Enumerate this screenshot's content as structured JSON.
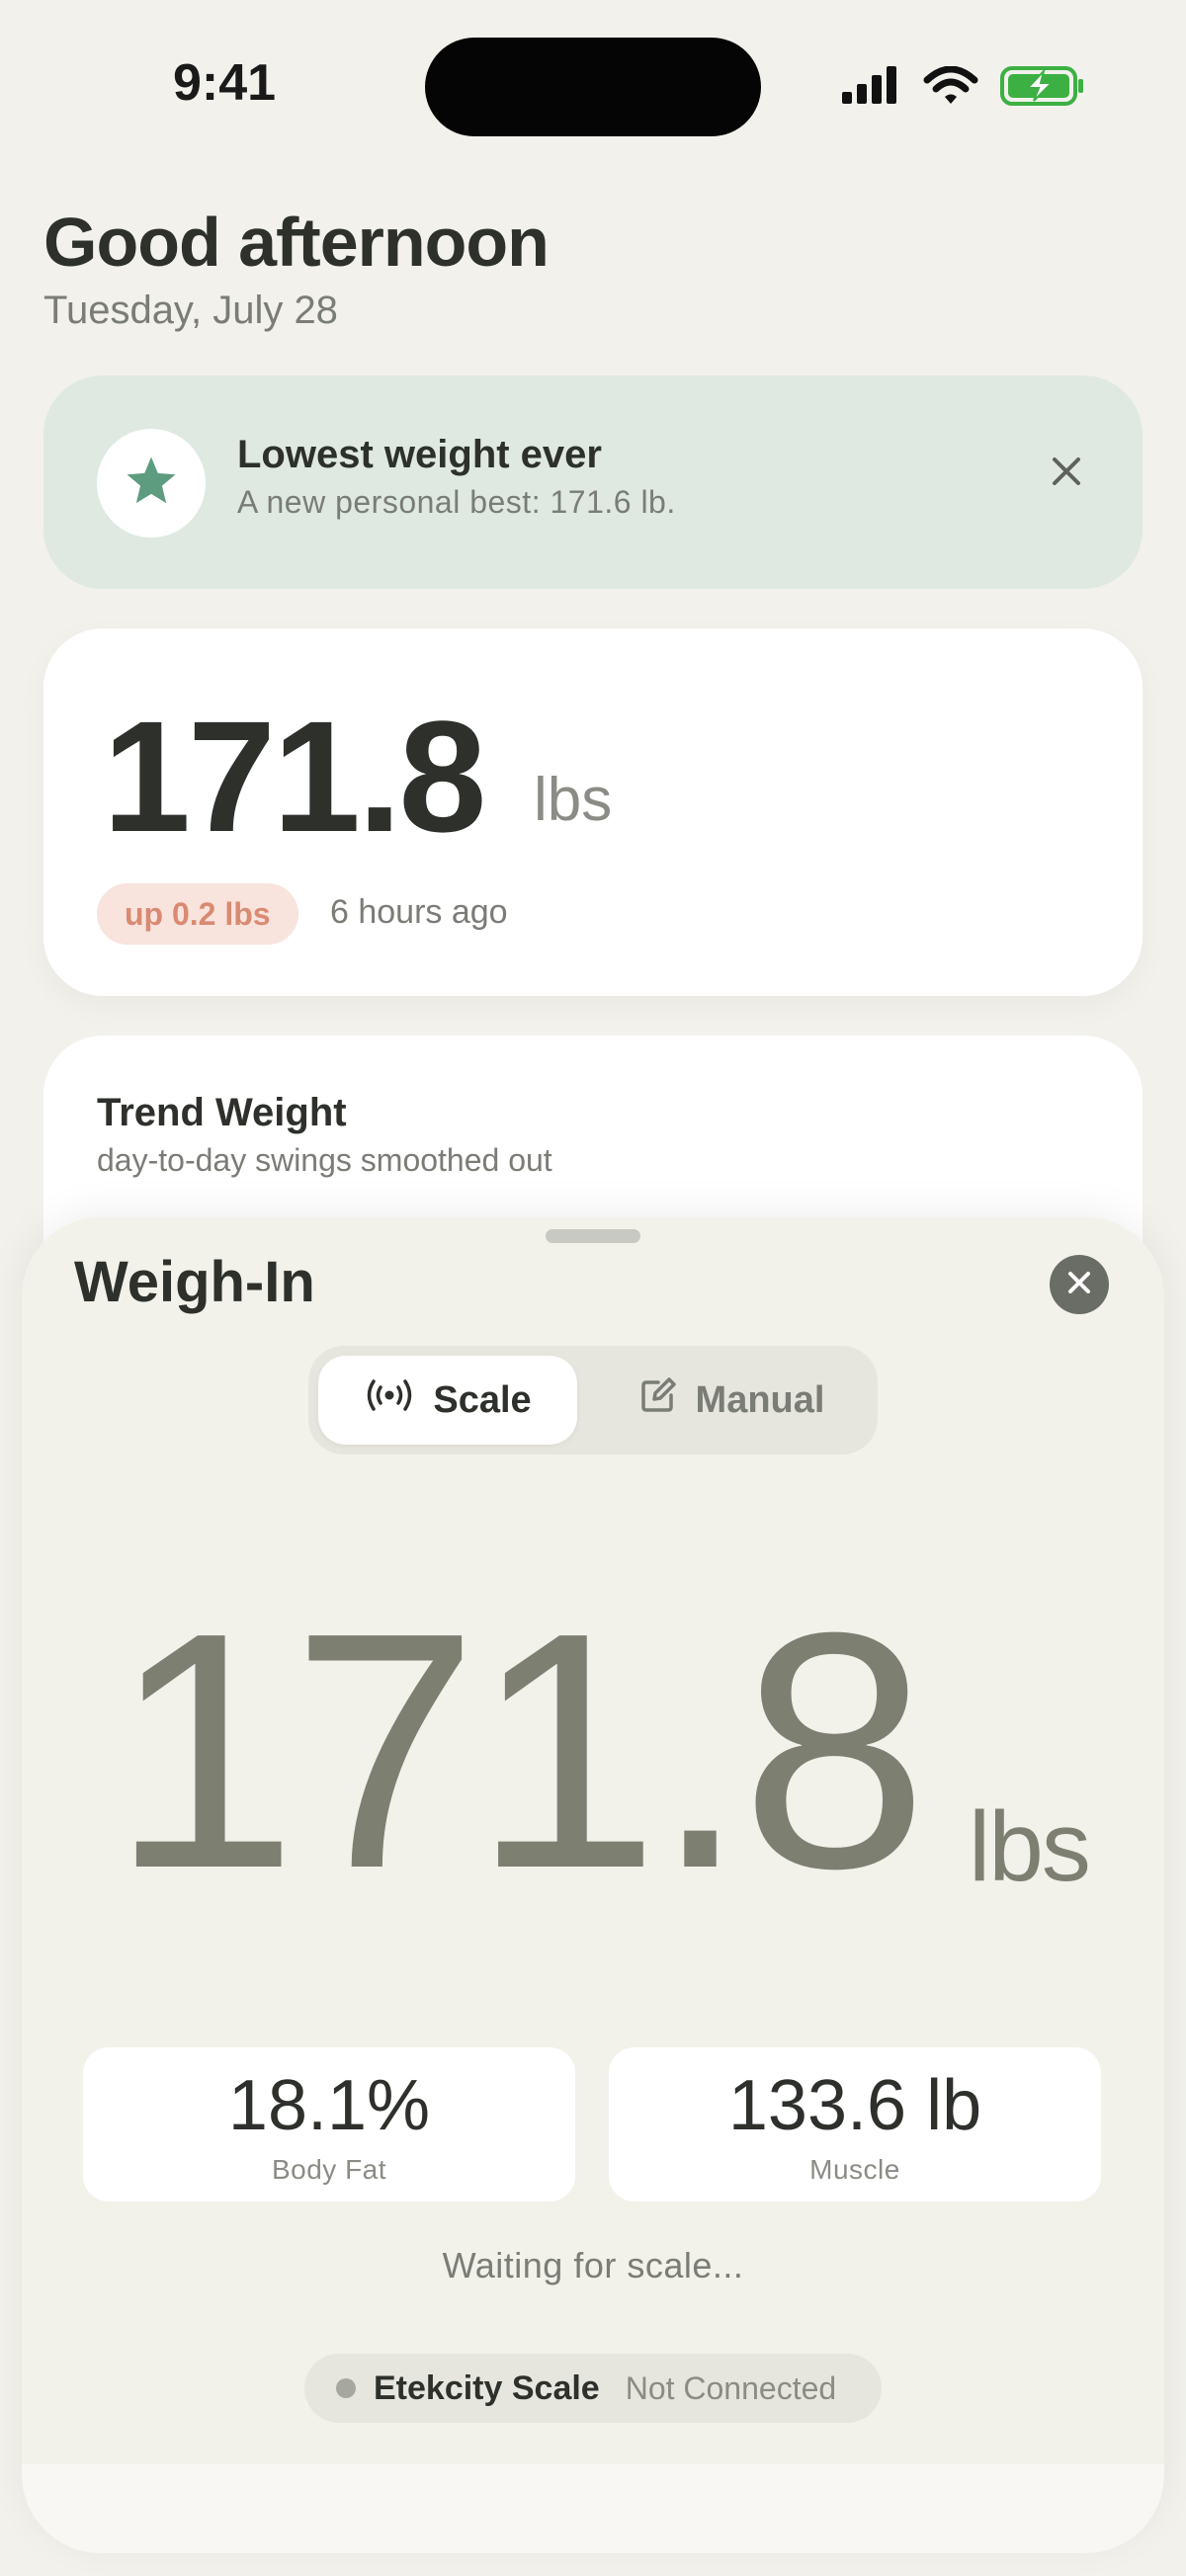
{
  "status_bar": {
    "time": "9:41"
  },
  "header": {
    "greeting": "Good afternoon",
    "date": "Tuesday, July 28"
  },
  "banner": {
    "title": "Lowest weight ever",
    "subtitle": "A new personal best: 171.6 lb.",
    "icon": "star-icon",
    "accent": "#5e9c7f"
  },
  "current": {
    "value": "171.8",
    "unit": "lbs",
    "change": "up 0.2 lbs",
    "time_ago": "6 hours ago"
  },
  "trend": {
    "title": "Trend Weight",
    "subtitle": "day-to-day swings smoothed out"
  },
  "sheet": {
    "title": "Weigh-In",
    "tabs": [
      {
        "label": "Scale",
        "icon": "broadcast-icon",
        "selected": true
      },
      {
        "label": "Manual",
        "icon": "edit-icon",
        "selected": false
      }
    ],
    "reading": {
      "value": "171.8",
      "unit": "lbs"
    },
    "metrics": [
      {
        "value": "18.1%",
        "label": "Body Fat"
      },
      {
        "value": "133.6 lb",
        "label": "Muscle"
      }
    ],
    "waiting_text": "Waiting for scale...",
    "device": {
      "name": "Etekcity Scale",
      "status": "Not Connected"
    }
  }
}
